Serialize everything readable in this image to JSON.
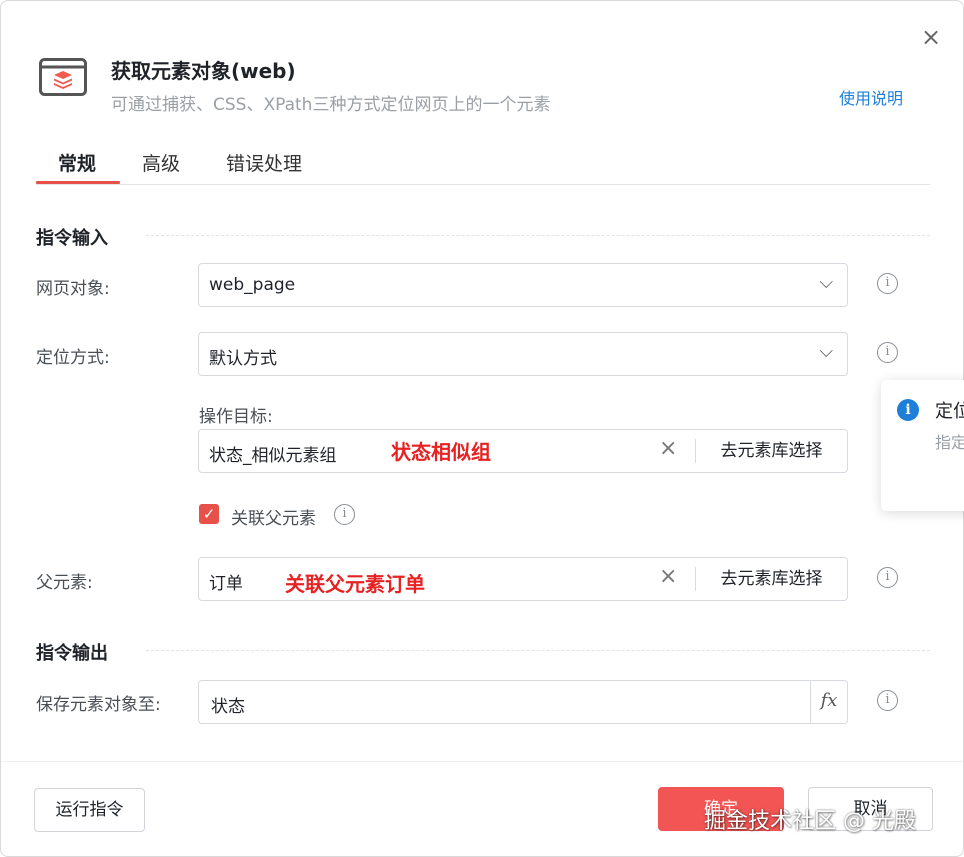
{
  "dialog": {
    "title": "获取元素对象(web)",
    "subtitle": "可通过捕获、CSS、XPath三种方式定位网页上的一个元素",
    "help_link": "使用说明",
    "close_glyph": "×",
    "app_icon": "browser-layers-icon"
  },
  "tabs": [
    {
      "label": "常规",
      "active": true
    },
    {
      "label": "高级",
      "active": false
    },
    {
      "label": "错误处理",
      "active": false
    }
  ],
  "sections": {
    "input_title": "指令输入",
    "output_title": "指令输出"
  },
  "fields": {
    "web_page": {
      "label": "网页对象:",
      "value": "web_page"
    },
    "locate_mode": {
      "label": "定位方式:",
      "value": "默认方式"
    },
    "target": {
      "label": "操作目标:",
      "value": "状态_相似元素组",
      "note": "状态相似组",
      "library_button": "去元素库选择"
    },
    "link_parent": {
      "label": "关联父元素",
      "checked": true
    },
    "parent": {
      "label": "父元素:",
      "value": "订单",
      "note": "关联父元素订单",
      "library_button": "去元素库选择"
    },
    "save_to": {
      "label": "保存元素对象至:",
      "value": "状态",
      "fx": "fx"
    }
  },
  "footer": {
    "run": "运行指令",
    "ok": "确定",
    "cancel": "取消"
  },
  "tooltip": {
    "title": "定位",
    "desc": "指定"
  },
  "watermark": "掘金技术社区 @ 光殿",
  "colors": {
    "accent": "#e8504a",
    "primary_button": "#f25553",
    "link": "#1e7fd8",
    "annotation": "#e62222"
  }
}
